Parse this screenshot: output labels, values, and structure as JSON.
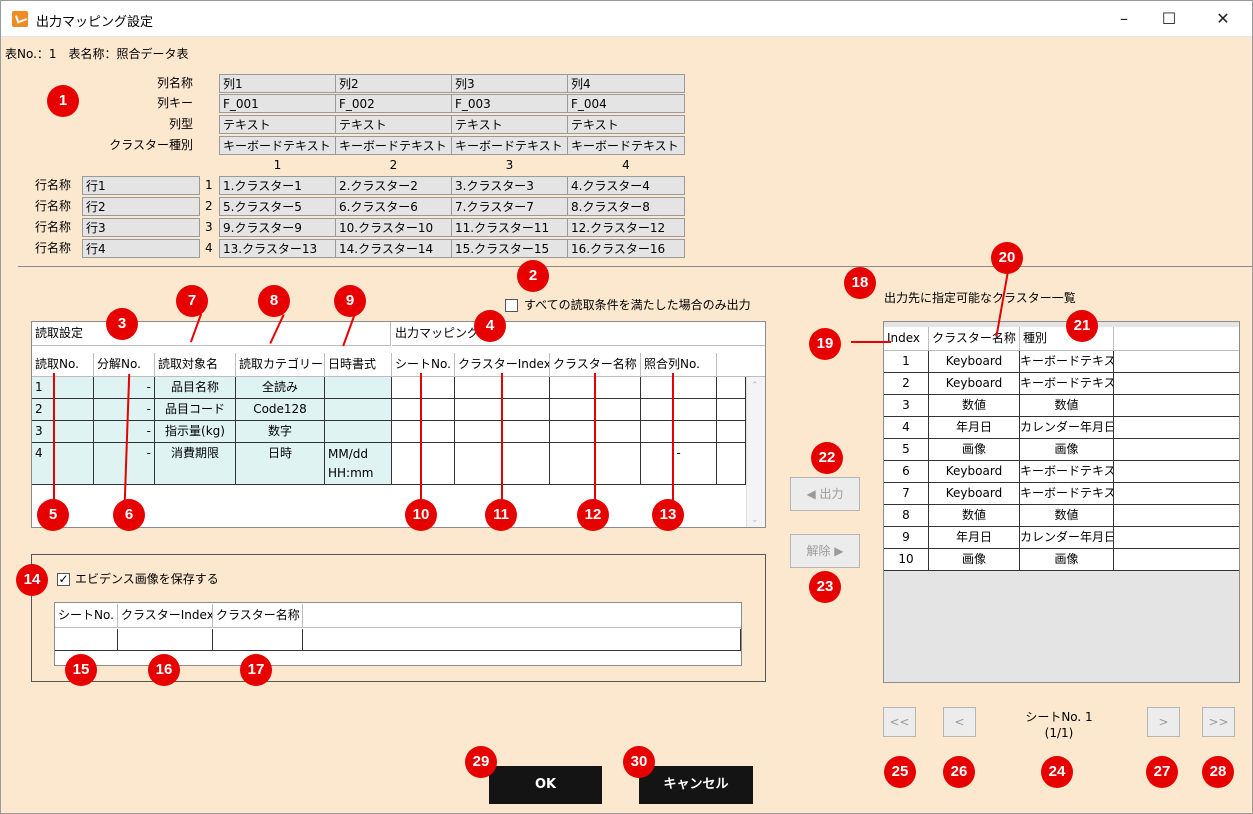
{
  "window": {
    "title": "出力マッピング設定",
    "minimize": "–",
    "maximize": "☐",
    "close": "✕"
  },
  "table_info": "表No.：1　表名称：照合データ表",
  "mapping": {
    "row_labels": [
      "列名称",
      "列キー",
      "列型",
      "クラスター種別"
    ],
    "columns": [
      {
        "name": "列1",
        "key": "F_001",
        "type": "テキスト",
        "cluster": "キーボードテキスト",
        "num": "1"
      },
      {
        "name": "列2",
        "key": "F_002",
        "type": "テキスト",
        "cluster": "キーボードテキスト",
        "num": "2"
      },
      {
        "name": "列3",
        "key": "F_003",
        "type": "テキスト",
        "cluster": "キーボードテキスト",
        "num": "3"
      },
      {
        "name": "列4",
        "key": "F_004",
        "type": "テキスト",
        "cluster": "キーボードテキスト",
        "num": "4"
      }
    ],
    "row_name_label": "行名称",
    "rows": [
      {
        "name": "行1",
        "num": "1",
        "cells": [
          "1.クラスター1",
          "2.クラスター2",
          "3.クラスター3",
          "4.クラスター4"
        ]
      },
      {
        "name": "行2",
        "num": "2",
        "cells": [
          "5.クラスター5",
          "6.クラスター6",
          "7.クラスター7",
          "8.クラスター8"
        ]
      },
      {
        "name": "行3",
        "num": "3",
        "cells": [
          "9.クラスター9",
          "10.クラスター10",
          "11.クラスター11",
          "12.クラスター12"
        ]
      },
      {
        "name": "行4",
        "num": "4",
        "cells": [
          "13.クラスター13",
          "14.クラスター14",
          "15.クラスター15",
          "16.クラスター16"
        ]
      }
    ]
  },
  "condition_checkbox": "すべての読取条件を満たした場合のみ出力",
  "read_grid": {
    "group_read": "読取設定",
    "group_output": "出力マッピング",
    "headers": [
      "読取No.",
      "分解No.",
      "読取対象名",
      "読取カテゴリー",
      "日時書式",
      "シートNo.",
      "クラスターIndex",
      "クラスター名称",
      "照合列No."
    ],
    "rows": [
      [
        "1",
        "-",
        "品目名称",
        "全読み",
        "",
        "",
        "",
        "",
        ""
      ],
      [
        "2",
        "-",
        "品目コード",
        "Code128",
        "",
        "",
        "",
        "",
        ""
      ],
      [
        "3",
        "-",
        "指示量(kg)",
        "数字",
        "",
        "",
        "",
        "",
        ""
      ],
      [
        "4",
        "-",
        "消費期限",
        "日時",
        "MM/dd HH:mm",
        "",
        "",
        "",
        "-"
      ]
    ]
  },
  "evidence": {
    "label": "エビデンス画像を保存する",
    "checked": "✓",
    "headers": [
      "シートNo.",
      "クラスターIndex",
      "クラスター名称"
    ]
  },
  "buttons": {
    "output": "◀ 出力",
    "release": "解除 ▶",
    "ok": "OK",
    "cancel": "キャンセル",
    "first": "<<",
    "prev": "<",
    "next": ">",
    "last": ">>"
  },
  "cluster_list": {
    "title": "出力先に指定可能なクラスター一覧",
    "headers": [
      "Index",
      "クラスター名称",
      "種別"
    ],
    "rows": [
      [
        "1",
        "Keyboard",
        "キーボードテキスト"
      ],
      [
        "2",
        "Keyboard",
        "キーボードテキスト"
      ],
      [
        "3",
        "数値",
        "数値"
      ],
      [
        "4",
        "年月日",
        "カレンダー年月日"
      ],
      [
        "5",
        "画像",
        "画像"
      ],
      [
        "6",
        "Keyboard",
        "キーボードテキスト"
      ],
      [
        "7",
        "Keyboard",
        "キーボードテキスト"
      ],
      [
        "8",
        "数値",
        "数値"
      ],
      [
        "9",
        "年月日",
        "カレンダー年月日"
      ],
      [
        "10",
        "画像",
        "画像"
      ]
    ]
  },
  "sheet": {
    "label": "シートNo. 1",
    "pages": "(1/1)"
  },
  "badges": [
    "1",
    "2",
    "3",
    "4",
    "5",
    "6",
    "7",
    "8",
    "9",
    "10",
    "11",
    "12",
    "13",
    "14",
    "15",
    "16",
    "17",
    "18",
    "19",
    "20",
    "21",
    "22",
    "23",
    "24",
    "25",
    "26",
    "27",
    "28",
    "29",
    "30"
  ],
  "colors": {
    "background": "#fce7cf",
    "badge": "#e60000",
    "grid_header_fill": "#e4e4e4",
    "read_row_fill": "#dff3f3",
    "dark_button": "#141414"
  }
}
